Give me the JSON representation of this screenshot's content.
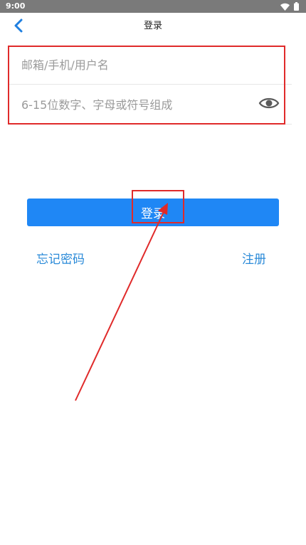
{
  "status_bar": {
    "time": "9:00",
    "icons": [
      "wifi-icon",
      "battery-icon"
    ]
  },
  "app_bar": {
    "title": "登录",
    "back_icon": "chevron-left-icon"
  },
  "form": {
    "account_placeholder": "邮箱/手机/用户名",
    "account_value": "",
    "password_placeholder": "6-15位数字、字母或符号组成",
    "password_value": "",
    "eye_icon": "eye-icon"
  },
  "actions": {
    "login_label": "登录",
    "forgot_label": "忘记密码",
    "register_label": "注册"
  },
  "colors": {
    "primary": "#1f87f5",
    "link": "#2a8ad8",
    "annotation": "#e02a2a",
    "status_bar": "#7a7a7a"
  }
}
